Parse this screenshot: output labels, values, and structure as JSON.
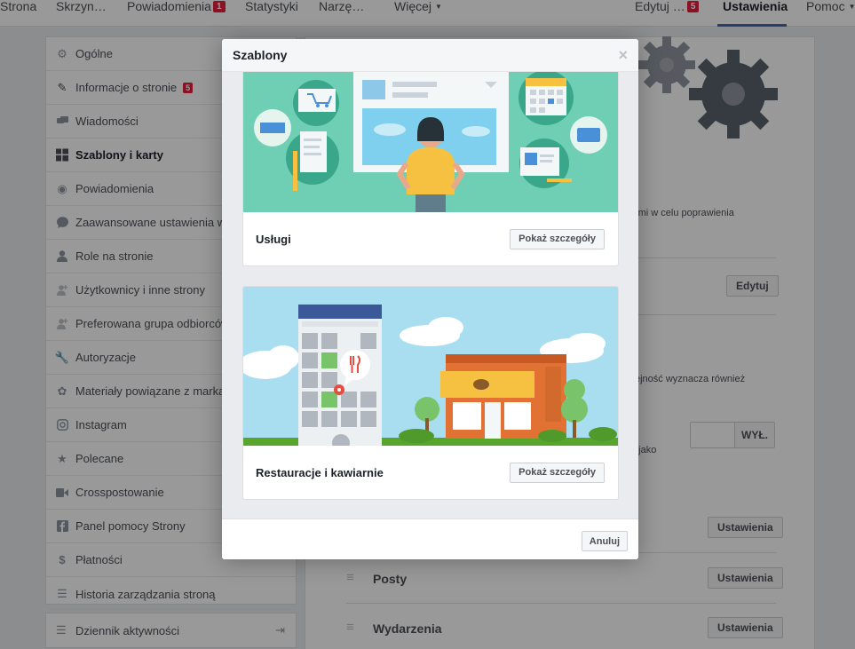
{
  "topnav": {
    "items": [
      {
        "label": "Strona"
      },
      {
        "label": "Skrzyn…"
      },
      {
        "label": "Powiadomienia",
        "badge": "1"
      },
      {
        "label": "Statystyki"
      },
      {
        "label": "Narzę…"
      },
      {
        "label": "Więcej"
      },
      {
        "label": "Edytuj …",
        "badge": "5"
      },
      {
        "label": "Ustawienia"
      },
      {
        "label": "Pomoc"
      }
    ]
  },
  "sidebar": {
    "items": [
      {
        "label": "Ogólne",
        "icon": "gear-icon"
      },
      {
        "label": "Informacje o stronie",
        "icon": "pencil-icon",
        "badge": "5"
      },
      {
        "label": "Wiadomości",
        "icon": "chat-icon"
      },
      {
        "label": "Szablony i karty",
        "icon": "grid-icon"
      },
      {
        "label": "Powiadomienia",
        "icon": "globe-icon"
      },
      {
        "label": "Zaawansowane ustawienia w",
        "icon": "messenger-icon"
      },
      {
        "label": "Role na stronie",
        "icon": "person-icon"
      },
      {
        "label": "Użytkownicy i inne strony",
        "icon": "person-plus-icon"
      },
      {
        "label": "Preferowana grupa odbiorców",
        "icon": "person-plus-icon"
      },
      {
        "label": "Autoryzacje",
        "icon": "wrench-icon"
      },
      {
        "label": "Materiały powiązane z marka",
        "icon": "handshake-icon"
      },
      {
        "label": "Instagram",
        "icon": "instagram-icon"
      },
      {
        "label": "Polecane",
        "icon": "star-icon"
      },
      {
        "label": "Crosspostowanie",
        "icon": "video-icon"
      },
      {
        "label": "Panel pomocy Strony",
        "icon": "facebook-icon"
      },
      {
        "label": "Płatności",
        "icon": "dollar-icon"
      },
      {
        "label": "Historia zarządzania stroną",
        "icon": "history-icon"
      }
    ],
    "activity_log": "Dziennik aktywności"
  },
  "main": {
    "snippet_1": "nymi w celu poprawienia",
    "edit_button": "Edytuj",
    "snippet_2": "ejność wyznacza również",
    "snippet_3": "n jako",
    "toggle_label": "WYŁ.",
    "settings_button": "Ustawienia",
    "rows": [
      {
        "label": "Posty"
      },
      {
        "label": "Wydarzenia"
      }
    ]
  },
  "modal": {
    "title": "Szablony",
    "close_symbol": "×",
    "cards": [
      {
        "title": "Usługi",
        "button": "Pokaż szczegóły"
      },
      {
        "title": "Restauracje i kawiarnie",
        "button": "Pokaż szczegóły"
      }
    ],
    "cancel_button": "Anuluj"
  },
  "colors": {
    "accent": "#4267b2",
    "badge": "#e41e3f",
    "teal": "#6fcfb5",
    "sky": "#a8def0"
  }
}
